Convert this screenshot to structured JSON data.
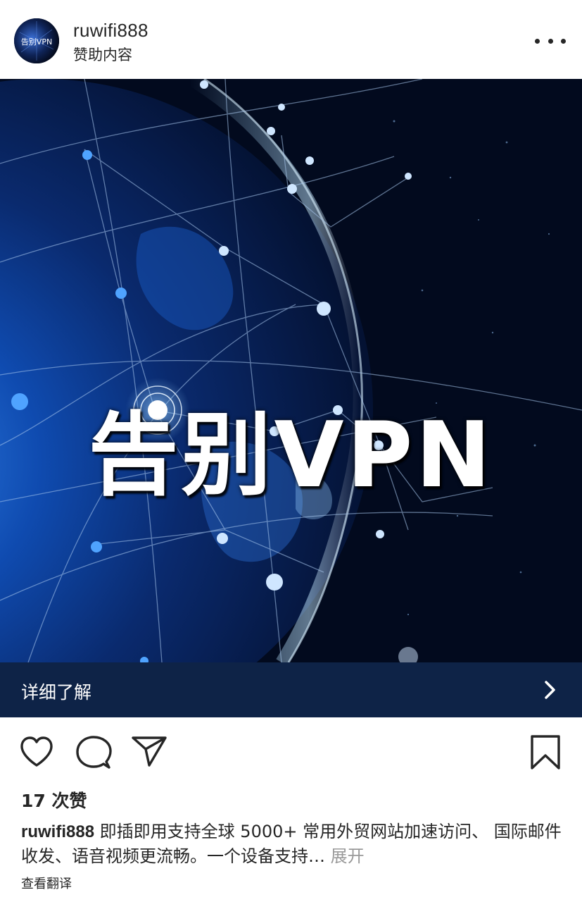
{
  "post": {
    "author": {
      "username": "ruwifi888",
      "subtitle": "赞助内容",
      "avatar_text": "告别VPN"
    },
    "image": {
      "headline": "告别VPN"
    },
    "cta": {
      "label": "详细了解"
    },
    "likes_text": "17 次赞",
    "caption": {
      "username": "ruwifi888",
      "text": " 即插即用支持全球 5000+ 常用外贸网站加速访问、 国际邮件收发、语音视频更流畅。一个设备支持…",
      "more_label": " 展开"
    },
    "translate_label": "查看翻译"
  },
  "icons": {
    "like": "heart-icon",
    "comment": "comment-icon",
    "share": "send-icon",
    "save": "bookmark-icon",
    "more": "more-horizontal-icon",
    "cta": "chevron-right-icon"
  },
  "colors": {
    "cta_background": "#0e2347",
    "text": "#262626",
    "muted": "#999999",
    "image_background": "#020a1e"
  }
}
